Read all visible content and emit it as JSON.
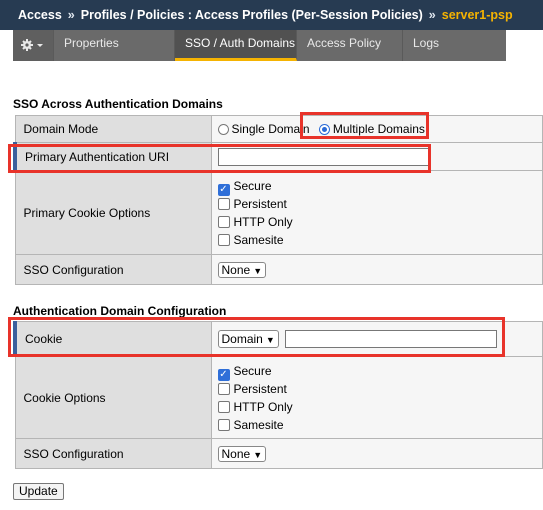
{
  "breadcrumb": {
    "items": [
      "Access",
      "Profiles / Policies : Access Profiles (Per-Session Policies)"
    ],
    "separator": "»",
    "current": "server1-psp"
  },
  "tabs": {
    "gear_icon": "gear-icon",
    "items": [
      {
        "label": "Properties",
        "active": false
      },
      {
        "label": "SSO / Auth Domains",
        "active": true
      },
      {
        "label": "Access Policy",
        "active": false
      },
      {
        "label": "Logs",
        "active": false
      }
    ]
  },
  "sso_section": {
    "title": "SSO Across Authentication Domains",
    "domain_mode": {
      "label": "Domain Mode",
      "options": [
        "Single Domain",
        "Multiple Domains"
      ],
      "selected": "Multiple Domains"
    },
    "primary_auth_uri": {
      "label": "Primary Authentication URI",
      "value": ""
    },
    "primary_cookie_options": {
      "label": "Primary Cookie Options",
      "options": [
        {
          "label": "Secure",
          "checked": true
        },
        {
          "label": "Persistent",
          "checked": false
        },
        {
          "label": "HTTP Only",
          "checked": false
        },
        {
          "label": "Samesite",
          "checked": false
        }
      ]
    },
    "sso_configuration": {
      "label": "SSO Configuration",
      "value": "None"
    }
  },
  "auth_domain_section": {
    "title": "Authentication Domain Configuration",
    "cookie": {
      "label": "Cookie",
      "type_value": "Domain",
      "value": ""
    },
    "cookie_options": {
      "label": "Cookie Options",
      "options": [
        {
          "label": "Secure",
          "checked": true
        },
        {
          "label": "Persistent",
          "checked": false
        },
        {
          "label": "HTTP Only",
          "checked": false
        },
        {
          "label": "Samesite",
          "checked": false
        }
      ]
    },
    "sso_configuration": {
      "label": "SSO Configuration",
      "value": "None"
    }
  },
  "update_label": "Update",
  "colors": {
    "highlight": "#e8332a",
    "active_tab_underline": "#f5b301",
    "header_bg": "#273b52"
  }
}
